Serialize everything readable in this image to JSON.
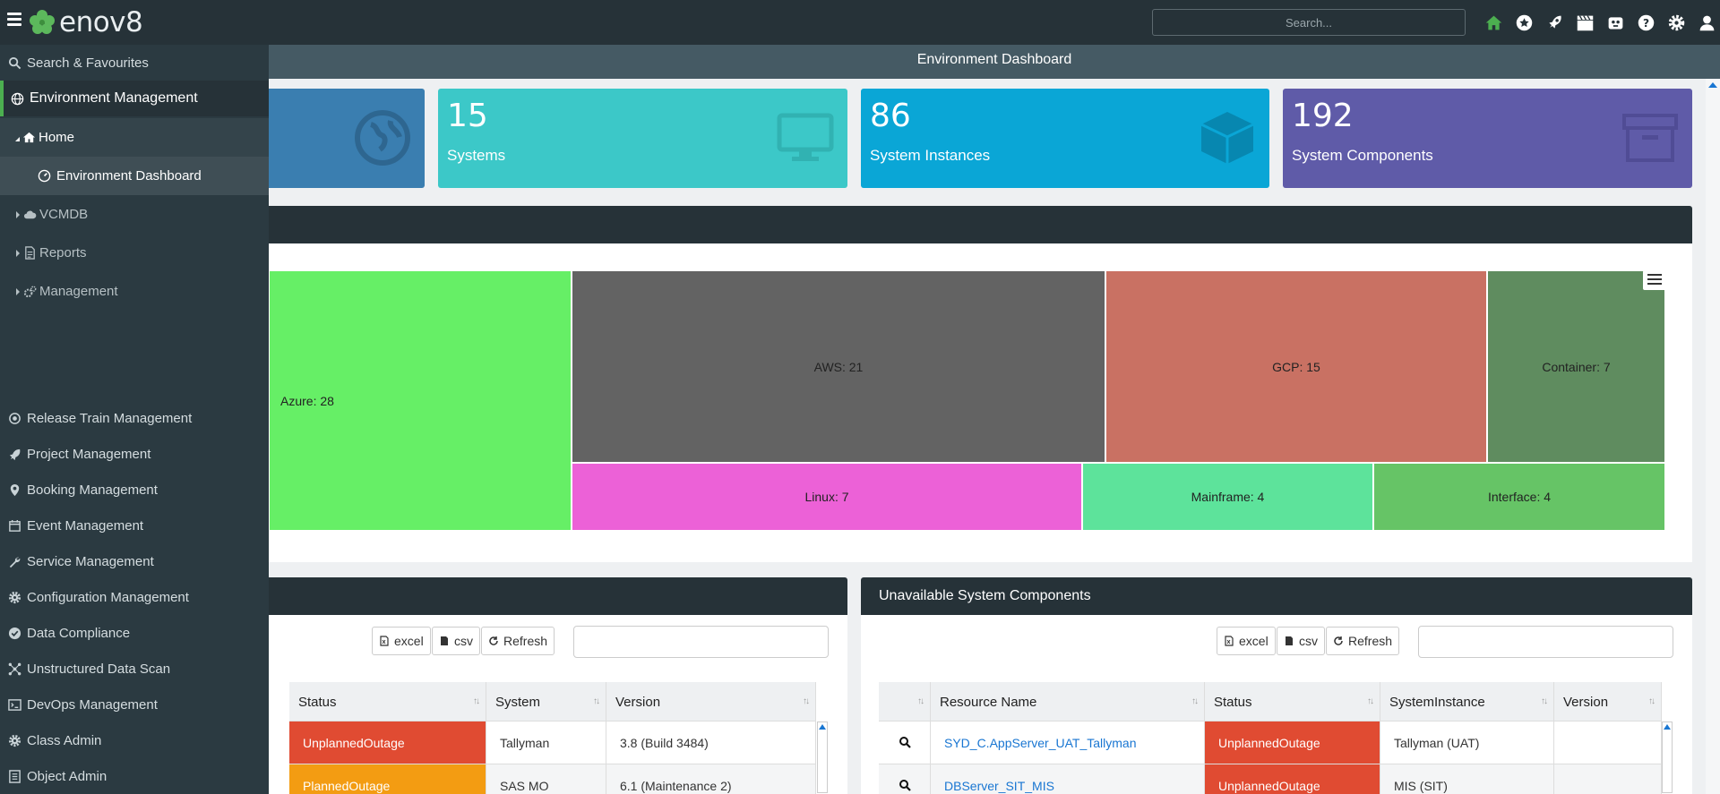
{
  "app": {
    "logo_text": "enov8"
  },
  "topbar": {
    "search_placeholder": "Search...",
    "icons": [
      "home-icon",
      "star-icon",
      "rocket-icon",
      "clapper-icon",
      "robot-icon",
      "help-icon",
      "gear-icon",
      "user-icon"
    ],
    "colors": {
      "home": "#4caf50",
      "default": "#ffffff"
    }
  },
  "page": {
    "title": "Environment Dashboard"
  },
  "stats": [
    {
      "value": "",
      "label": "",
      "icon": "globe-icon",
      "color": "#3a7eb0"
    },
    {
      "value": "15",
      "label": "Systems",
      "icon": "monitor-icon",
      "color": "#3cc8c8"
    },
    {
      "value": "86",
      "label": "System Instances",
      "icon": "cube-icon",
      "color": "#0aa6d6"
    },
    {
      "value": "192",
      "label": "System Components",
      "icon": "archive-icon",
      "color": "#5f5ba8"
    }
  ],
  "treemap": {
    "type": "treemap",
    "items": [
      {
        "label": "Azure: 28",
        "value": 28,
        "color": "#66ef66"
      },
      {
        "label": "AWS: 21",
        "value": 21,
        "color": "#636363"
      },
      {
        "label": "GCP: 15",
        "value": 15,
        "color": "#c97163"
      },
      {
        "label": "Container: 7",
        "value": 7,
        "color": "#5f8c5f"
      },
      {
        "label": "Linux: 7",
        "value": 7,
        "color": "#ec61d7"
      },
      {
        "label": "Mainframe: 4",
        "value": 4,
        "color": "#5de39b"
      },
      {
        "label": "Interface: 4",
        "value": 4,
        "color": "#66c466"
      }
    ]
  },
  "table_left": {
    "buttons": {
      "excel": "excel",
      "csv": "csv",
      "refresh": "Refresh"
    },
    "columns": [
      "Status",
      "System",
      "Version"
    ],
    "rows": [
      {
        "status": "UnplannedOutage",
        "system": "Tallyman",
        "version": "3.8 (Build 3484)"
      },
      {
        "status": "PlannedOutage",
        "system": "SAS MO",
        "version": "6.1 (Maintenance 2)"
      }
    ]
  },
  "table_right": {
    "title": "Unavailable System Components",
    "buttons": {
      "excel": "excel",
      "csv": "csv",
      "refresh": "Refresh"
    },
    "columns": [
      "",
      "Resource Name",
      "Status",
      "SystemInstance",
      "Version"
    ],
    "rows": [
      {
        "resource": "SYD_C.AppServer_UAT_Tallyman",
        "status": "UnplannedOutage",
        "instance": "Tallyman (UAT)",
        "version": ""
      },
      {
        "resource": "DBServer_SIT_MIS",
        "status": "UnplannedOutage",
        "instance": "MIS (SIT)",
        "version": ""
      }
    ]
  },
  "sidebar": {
    "search": "Search & Favourites",
    "environment": "Environment Management",
    "home": "Home",
    "dashboard": "Environment Dashboard",
    "sub": [
      "VCMDB",
      "Reports",
      "Management"
    ],
    "modules": [
      "Release Train Management",
      "Project Management",
      "Booking Management",
      "Event Management",
      "Service Management",
      "Configuration Management",
      "Data Compliance",
      "Unstructured Data Scan",
      "DevOps Management",
      "Class Admin",
      "Object Admin"
    ]
  }
}
